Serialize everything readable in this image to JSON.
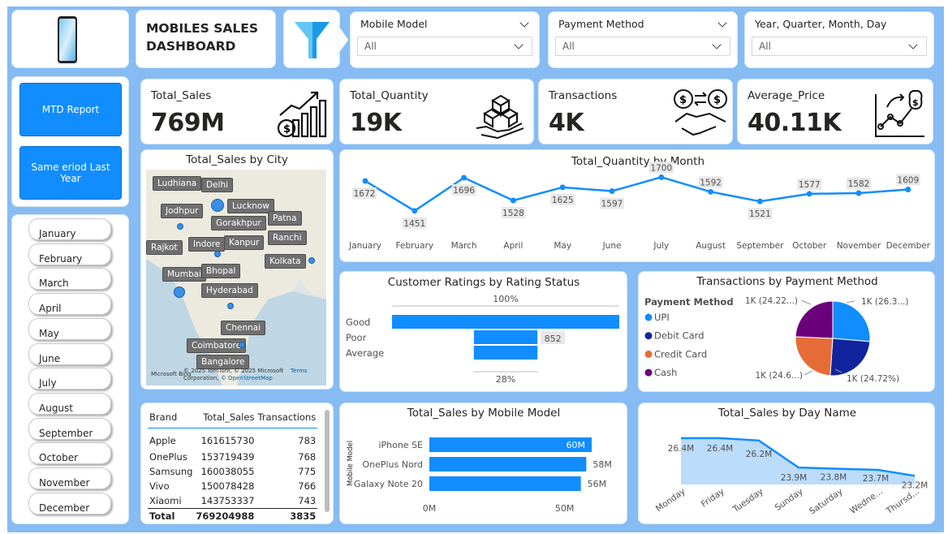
{
  "header": {
    "title_line1": "MOBILES SALES",
    "title_line2": "DASHBOARD"
  },
  "filters": [
    {
      "label": "Mobile Model",
      "value": "All"
    },
    {
      "label": "Payment Method",
      "value": "All"
    },
    {
      "label": "Year, Quarter, Month, Day",
      "value": "All"
    }
  ],
  "nav_buttons": {
    "mtd": "MTD Report",
    "same_period": "Same eriod Last Year"
  },
  "months": [
    "January",
    "February",
    "March",
    "April",
    "May",
    "June",
    "July",
    "August",
    "September",
    "October",
    "November",
    "December"
  ],
  "kpis": [
    {
      "label": "Total_Sales",
      "value": "769M",
      "icon": "sales-growth-icon"
    },
    {
      "label": "Total_Quantity",
      "value": "19K",
      "icon": "boxes-hand-icon"
    },
    {
      "label": "Transactions",
      "value": "4K",
      "icon": "dollar-handshake-icon"
    },
    {
      "label": "Average_Price",
      "value": "40.11K",
      "icon": "price-trend-icon"
    }
  ],
  "map": {
    "title": "Total_Sales by City",
    "cities": [
      "Ludhiana",
      "Delhi",
      "Lucknow",
      "Jodhpur",
      "Gorakhpur",
      "Patna",
      "Rajkot",
      "Indore",
      "Kanpur",
      "Ranchi",
      "Kolkata",
      "Mumbai",
      "Bhopal",
      "Hyderabad",
      "Chennai",
      "Coimbatore",
      "Bangalore"
    ],
    "attribution": "© 2025 TomTom, © 2025 Microsoft Corporation,",
    "osm": "© OpenStreetMap",
    "terms": "Terms",
    "logo": "Microsoft Bing"
  },
  "chart_data": [
    {
      "type": "line",
      "title": "Total_Quantity by Month",
      "categories": [
        "January",
        "February",
        "March",
        "April",
        "May",
        "June",
        "July",
        "August",
        "September",
        "October",
        "November",
        "December"
      ],
      "values": [
        1672,
        1451,
        1696,
        1528,
        1625,
        1597,
        1700,
        1592,
        1521,
        1577,
        1582,
        1609
      ],
      "color": "#118dff"
    },
    {
      "type": "bar",
      "title": "Customer Ratings by Rating Status",
      "subtype": "funnel",
      "categories": [
        "Good",
        "Poor",
        "Average"
      ],
      "values": [
        3050,
        852,
        854
      ],
      "labels": {
        "top": "100%",
        "middle": "852",
        "bottom": "28%"
      },
      "color": "#118dff"
    },
    {
      "type": "pie",
      "title": "Transactions by Payment Method",
      "legend_title": "Payment Method",
      "categories": [
        "UPI",
        "Debit Card",
        "Credit Card",
        "Cash"
      ],
      "values": [
        26.3,
        24.72,
        24.6,
        24.22
      ],
      "slice_labels": [
        "1K (26.3...)",
        "1K (24.72%)",
        "1K (24.6...)",
        "1K (24.22...)"
      ],
      "colors": [
        "#118dff",
        "#12239e",
        "#e66c37",
        "#6b007b"
      ]
    },
    {
      "type": "table",
      "columns": [
        "Brand",
        "Total_Sales",
        "Transactions"
      ],
      "rows": [
        [
          "Apple",
          "161615730",
          "783"
        ],
        [
          "OnePlus",
          "153719439",
          "768"
        ],
        [
          "Samsung",
          "160038055",
          "775"
        ],
        [
          "Vivo",
          "150078428",
          "766"
        ],
        [
          "Xiaomi",
          "143753337",
          "743"
        ]
      ],
      "total": [
        "Total",
        "769204988",
        "3835"
      ]
    },
    {
      "type": "bar",
      "title": "Total_Sales by Mobile Model",
      "ylabel": "Mobile Model",
      "categories": [
        "iPhone SE",
        "OnePlus Nord",
        "Galaxy Note 20"
      ],
      "values": [
        60,
        58,
        56
      ],
      "value_labels": [
        "60M",
        "58M",
        "56M"
      ],
      "xticks": [
        "0M",
        "50M"
      ],
      "xlim": [
        0,
        60
      ],
      "color": "#118dff"
    },
    {
      "type": "area",
      "title": "Total_Sales by Day Name",
      "categories": [
        "Monday",
        "Friday",
        "Tuesday",
        "Sunday",
        "Saturday",
        "Wedne...",
        "Thursd..."
      ],
      "values": [
        26.4,
        26.4,
        26.2,
        23.9,
        23.8,
        23.7,
        23.2
      ],
      "value_labels": [
        "26.4M",
        "26.4M",
        "26.2M",
        "23.9M",
        "23.8M",
        "23.7M",
        "23.2M"
      ],
      "color": "#118dff"
    }
  ]
}
